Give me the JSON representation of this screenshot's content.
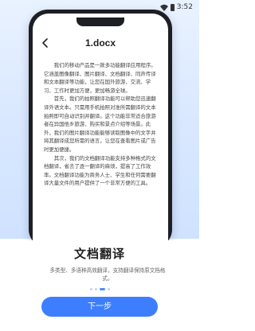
{
  "status_bar": {
    "time": "3:52"
  },
  "document": {
    "title": "1.docx",
    "paragraphs": [
      "我们的移动产品是一款多功能翻译应用程序。它涵盖图像翻译、图片翻译、文档翻译、同声传译和文本翻译等功能，让您在国外旅游、交流、学习、工作时更加方便，更加畅游全球。",
      "首先，我们的拍照翻译功能可以帮助您迅速翻译外语文本。只需用手机拍照对准所需翻译的文本拍照即可自动识别并翻译。这个功能非常适合旅游者在异国他乡旅游、购买和景点介绍等场景。此外，我们的图片翻译功能能够读取图像中的文字并将其翻译成您所需的语言，让您在查看图片或广告时更加便捷。",
      "其次，我们的文档翻译功能支持多种格式的文档翻译，省去了逐一翻译的麻烦，提高了工作效率。文档翻译功能为商务人士、学生和任何需要翻译大量文件的用户提供了一个非常方便的工具。"
    ]
  },
  "card": {
    "title": "文档翻译",
    "description": "多类型、多语种高效翻译，支持翻译保持原文档格式。"
  },
  "buttons": {
    "next_label": "下一步"
  },
  "colors": {
    "accent": "#3d7eff",
    "hero_bg": "#dbe9ff"
  }
}
